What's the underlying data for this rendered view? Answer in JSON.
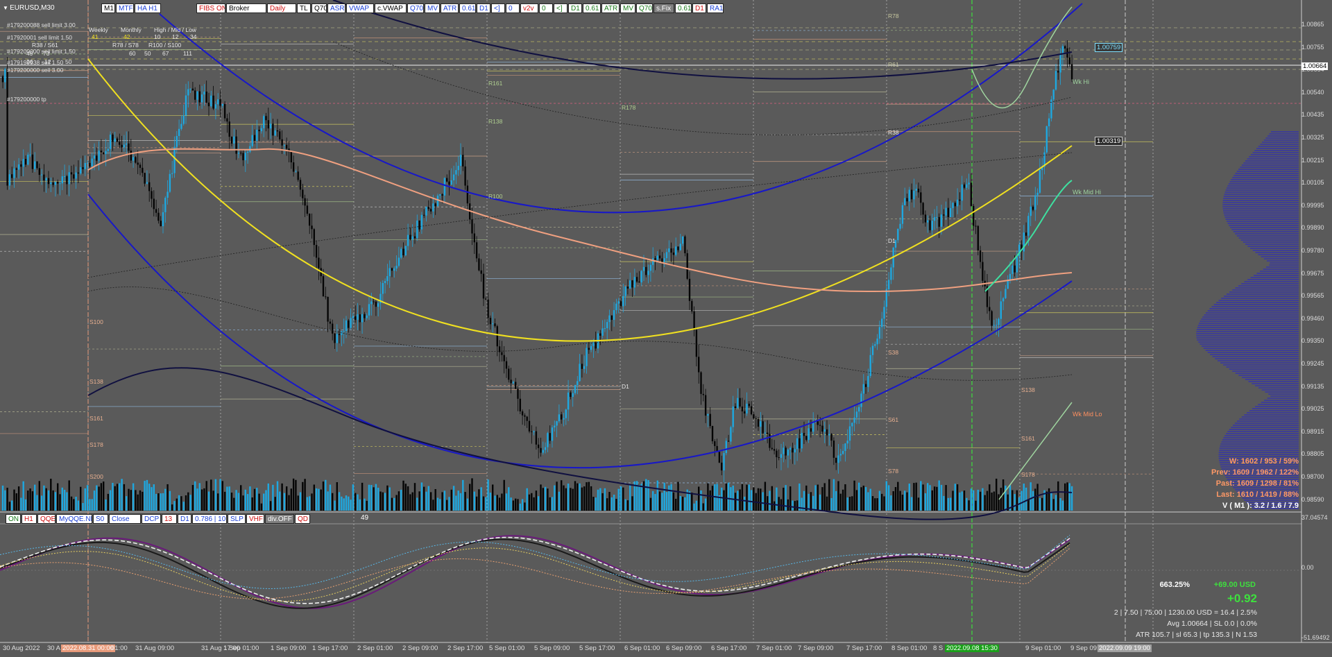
{
  "window": {
    "symbol": "EURUSD,M30"
  },
  "top_buttons": [
    {
      "label": "M1",
      "bg": "#ffffff",
      "fg": "#000000"
    },
    {
      "label": "MTF",
      "bg": "#ffffff",
      "fg": "#1a3fd6"
    },
    {
      "label": "HA H1",
      "bg": "#ffffff",
      "fg": "#1a3fd6"
    },
    {
      "label": "FIBS ON",
      "bg": "#ffffff",
      "fg": "#d01010"
    },
    {
      "label": "Broker",
      "bg": "#ffffff",
      "fg": "#000000"
    },
    {
      "label": "Daily",
      "bg": "#ffffff",
      "fg": "#d01010"
    },
    {
      "label": "TL",
      "bg": "#ffffff",
      "fg": "#000000"
    },
    {
      "label": "Q70",
      "bg": "#ffffff",
      "fg": "#000000"
    },
    {
      "label": "ASR",
      "bg": "#ffffff",
      "fg": "#1a3fd6"
    },
    {
      "label": "VWAP",
      "bg": "#ffffff",
      "fg": "#1a3fd6"
    },
    {
      "label": "c.VWAP",
      "bg": "#ffffff",
      "fg": "#000000"
    },
    {
      "label": "Q70",
      "bg": "#ffffff",
      "fg": "#1a3fd6"
    },
    {
      "label": "MV",
      "bg": "#ffffff",
      "fg": "#1a3fd6"
    },
    {
      "label": "ATR",
      "bg": "#ffffff",
      "fg": "#1a3fd6"
    },
    {
      "label": "0.61",
      "bg": "#ffffff",
      "fg": "#1a3fd6"
    },
    {
      "label": "D1",
      "bg": "#ffffff",
      "fg": "#1a3fd6"
    },
    {
      "label": "<]",
      "bg": "#ffffff",
      "fg": "#1a3fd6"
    },
    {
      "label": "0",
      "bg": "#ffffff",
      "fg": "#1a3fd6"
    },
    {
      "label": "v2v",
      "bg": "#ffffff",
      "fg": "#d01010"
    },
    {
      "label": "0",
      "bg": "#ffffff",
      "fg": "#1a7a1a"
    },
    {
      "label": "<]",
      "bg": "#ffffff",
      "fg": "#1a7a1a"
    },
    {
      "label": "D1",
      "bg": "#ffffff",
      "fg": "#1a7a1a"
    },
    {
      "label": "0.61",
      "bg": "#ffffff",
      "fg": "#1a7a1a"
    },
    {
      "label": "ATR",
      "bg": "#ffffff",
      "fg": "#1a7a1a"
    },
    {
      "label": "MV",
      "bg": "#ffffff",
      "fg": "#1a7a1a"
    },
    {
      "label": "Q70",
      "bg": "#ffffff",
      "fg": "#1a7a1a"
    },
    {
      "label": "s.Fix",
      "bg": "#7f7f7f",
      "fg": "#ffffff"
    },
    {
      "label": "0.61",
      "bg": "#ffffff",
      "fg": "#1a7a1a"
    },
    {
      "label": "D1",
      "bg": "#ffffff",
      "fg": "#d01010"
    },
    {
      "label": "RA1",
      "bg": "#ffffff",
      "fg": "#1a3fd6"
    }
  ],
  "info_panel": {
    "header": [
      "Weekly",
      "Monthly",
      "High / Mid / Low"
    ],
    "values_row": [
      "41",
      "42",
      "10",
      "12",
      "34"
    ],
    "row2": [
      "R38 / S61",
      "R78 / S78",
      "R100 / S100"
    ],
    "row3": [
      "49",
      "73",
      "60",
      "50",
      "67",
      "111"
    ],
    "row4": [
      "26",
      "12",
      "50"
    ],
    "orders": [
      "#179200088 sell limit 3.00",
      "#17920001 sell limit 1.50",
      "#179200000 sell limit 1.50",
      "#179199938 sell 1.50",
      "#179200000 sell 3.00",
      "#179200000 tp"
    ]
  },
  "price_axis": [
    "1.00865",
    "1.00755",
    "1.00664",
    "1.00540",
    "1.00435",
    "1.00325",
    "1.00215",
    "1.00105",
    "0.99995",
    "0.99890",
    "0.99780",
    "0.99675",
    "0.99565",
    "0.99460",
    "0.99350",
    "0.99245",
    "0.99135",
    "0.99025",
    "0.98915",
    "0.98805",
    "0.98700",
    "0.98590"
  ],
  "price_tags": {
    "current": "1.00664",
    "high": "1.00759",
    "low_tag": "1.00319"
  },
  "osc_axis": [
    "37.04574",
    "0.00",
    "-51.69492"
  ],
  "bottom_buttons": [
    {
      "label": "ON",
      "bg": "#ffffff",
      "fg": "#1a7a1a"
    },
    {
      "label": "H1",
      "bg": "#ffffff",
      "fg": "#d01010"
    },
    {
      "label": "QQE",
      "bg": "#ffffff",
      "fg": "#d01010"
    },
    {
      "label": "MyQQE.NET",
      "bg": "#ffffff",
      "fg": "#1a3fd6"
    },
    {
      "label": "S0",
      "bg": "#ffffff",
      "fg": "#1a3fd6"
    },
    {
      "label": "Close",
      "bg": "#ffffff",
      "fg": "#1a3fd6"
    },
    {
      "label": "DCP",
      "bg": "#ffffff",
      "fg": "#1a3fd6"
    },
    {
      "label": "13",
      "bg": "#ffffff",
      "fg": "#d01010"
    },
    {
      "label": "D1",
      "bg": "#ffffff",
      "fg": "#1a3fd6"
    },
    {
      "label": "0.786 | 10",
      "bg": "#ffffff",
      "fg": "#1a3fd6"
    },
    {
      "label": "SLP",
      "bg": "#ffffff",
      "fg": "#1a3fd6"
    },
    {
      "label": "VHF",
      "bg": "#ffffff",
      "fg": "#d01010"
    },
    {
      "label": "div.OFF",
      "bg": "#7f7f7f",
      "fg": "#ffffff"
    },
    {
      "label": "QD",
      "bg": "#ffffff",
      "fg": "#d01010"
    }
  ],
  "qd_value": "49",
  "time_axis": [
    "30 Aug 2022",
    "30 A",
    "2022.08.31 00:00",
    "01:00",
    "31 Aug 09:00",
    "31 Aug 17:00",
    "1 Sep 01:00",
    "1 Sep 09:00",
    "1 Sep 17:00",
    "2 Sep 01:00",
    "2 Sep 09:00",
    "2 Sep 17:00",
    "5 Sep 01:00",
    "5 Sep 09:00",
    "5 Sep 17:00",
    "6 Sep 01:00",
    "6 Sep 09:00",
    "6 Sep 17:00",
    "7 Sep 01:00",
    "7 Sep 09:00",
    "7 Sep 17:00",
    "8 Sep 01:00",
    "8 S",
    "2022.09.08 15:30",
    "9 Sep 01:00",
    "9 Sep 09:",
    "2022.09.09 19:00"
  ],
  "weekly_stats": [
    {
      "text": "W: 1602 / 953 / 59%",
      "color": "#ff9966"
    },
    {
      "text": "Prev: 1609 / 1962 / 122%",
      "color": "#ff9966"
    },
    {
      "text": "Past: 1609 / 1298 / 81%",
      "color": "#ff9966"
    },
    {
      "text": "Last: 1610 / 1419 / 88%",
      "color": "#ff9966"
    },
    {
      "text": "V ( M1 ): 3.2 / 1.6 / 7.9",
      "color": "#ffffff"
    }
  ],
  "account": {
    "pct": "663.25%",
    "usd": "+69.00 USD",
    "big": "+0.92",
    "line1": "2  |  7.50  |  75.00  |  1230.00 USD = 16.4  |  2.5%",
    "line2": "Avg 1.00664  |  SL 0.0  |  0.0%",
    "line3": "ATR 105.7  |  sl 65.3  |  tp 135.3  |  N 1.53"
  },
  "chart_labels": {
    "wk_hi": "Wk Hi",
    "wk_mid_hi": "Wk Mid Hi",
    "wk_mid_lo": "Wk Mid Lo"
  },
  "level_labels": [
    "R78",
    "R61",
    "R38",
    "D1",
    "S38",
    "S61",
    "S78",
    "S100",
    "S138",
    "S161",
    "S178",
    "S200",
    "R100",
    "R138",
    "R161",
    "R178",
    "D1",
    "S138",
    "S161",
    "S178"
  ],
  "colors": {
    "bg": "#5a5a5a",
    "bull": "#1ea8e0",
    "bear": "#050505",
    "ma_yellow": "#f0e020",
    "ma_salmon": "#f0a080",
    "band_blue": "#1010c0",
    "band_navy": "#101040"
  }
}
